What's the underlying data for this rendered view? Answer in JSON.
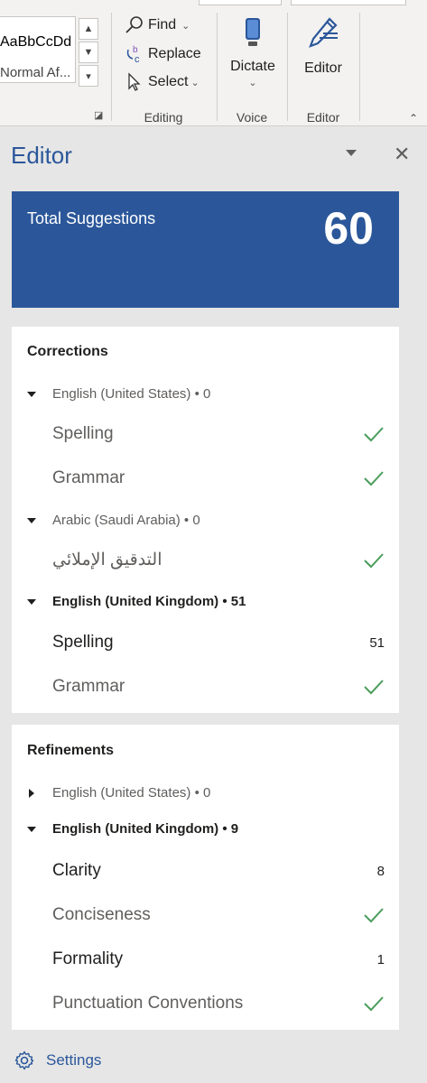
{
  "ribbon": {
    "styles": {
      "sample": "AaBbCcDd",
      "name": "Normal Af..."
    },
    "editing": {
      "find": "Find",
      "replace": "Replace",
      "select": "Select",
      "group_label": "Editing"
    },
    "voice": {
      "dictate": "Dictate",
      "group_label": "Voice"
    },
    "editor": {
      "button": "Editor",
      "group_label": "Editor"
    }
  },
  "pane": {
    "title": "Editor",
    "total": {
      "label": "Total Suggestions",
      "value": "60"
    },
    "corrections": {
      "title": "Corrections",
      "groups": [
        {
          "language": "English (United States) • 0",
          "items": [
            {
              "label": "Spelling",
              "status": "check"
            },
            {
              "label": "Grammar",
              "status": "check"
            }
          ]
        },
        {
          "language": "Arabic (Saudi Arabia) • 0",
          "items": [
            {
              "label": "التدقيق الإملائي",
              "status": "check"
            }
          ]
        },
        {
          "language": "English (United Kingdom) • 51",
          "items": [
            {
              "label": "Spelling",
              "count": "51"
            },
            {
              "label": "Grammar",
              "status": "check"
            }
          ]
        }
      ]
    },
    "refinements": {
      "title": "Refinements",
      "groups": [
        {
          "language": "English (United States) • 0",
          "collapsed": true
        },
        {
          "language": "English (United Kingdom) • 9",
          "items": [
            {
              "label": "Clarity",
              "count": "8"
            },
            {
              "label": "Conciseness",
              "status": "check"
            },
            {
              "label": "Formality",
              "count": "1"
            },
            {
              "label": "Punctuation Conventions",
              "status": "check"
            }
          ]
        }
      ]
    },
    "settings": "Settings"
  },
  "colors": {
    "accent": "#2b579a",
    "check": "#4a9d5b"
  }
}
